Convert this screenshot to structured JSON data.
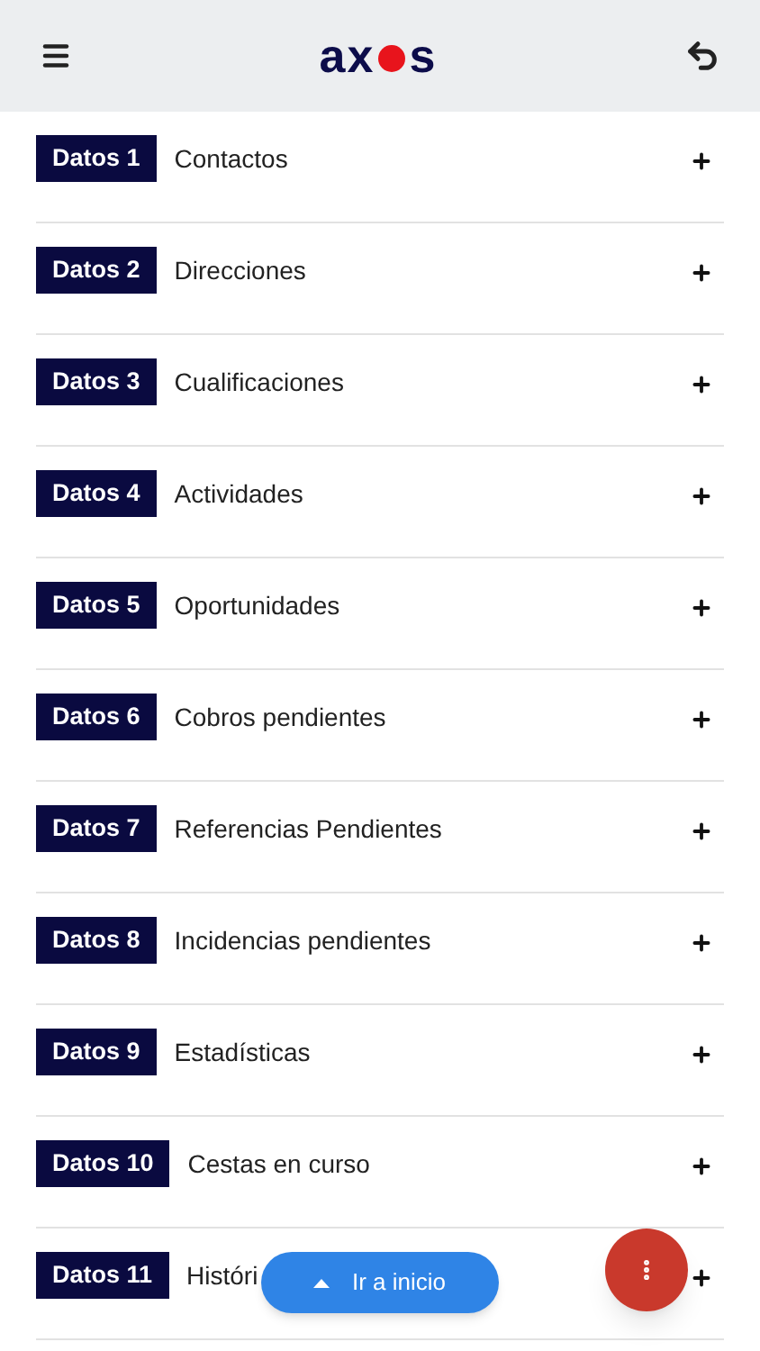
{
  "header": {
    "logo": {
      "before": "ax",
      "after": "s"
    }
  },
  "items": [
    {
      "badge": "Datos 1",
      "title": "Contactos"
    },
    {
      "badge": "Datos 2",
      "title": "Direcciones"
    },
    {
      "badge": "Datos 3",
      "title": "Cualificaciones"
    },
    {
      "badge": "Datos 4",
      "title": "Actividades"
    },
    {
      "badge": "Datos 5",
      "title": "Oportunidades"
    },
    {
      "badge": "Datos 6",
      "title": "Cobros pendientes"
    },
    {
      "badge": "Datos 7",
      "title": "Referencias Pendientes"
    },
    {
      "badge": "Datos 8",
      "title": "Incidencias pendientes"
    },
    {
      "badge": "Datos 9",
      "title": "Estadísticas"
    },
    {
      "badge": "Datos 10",
      "title": "Cestas en curso"
    },
    {
      "badge": "Datos 11",
      "title": "Históri"
    }
  ],
  "scroll_top_button": {
    "label": "Ir a inicio"
  }
}
